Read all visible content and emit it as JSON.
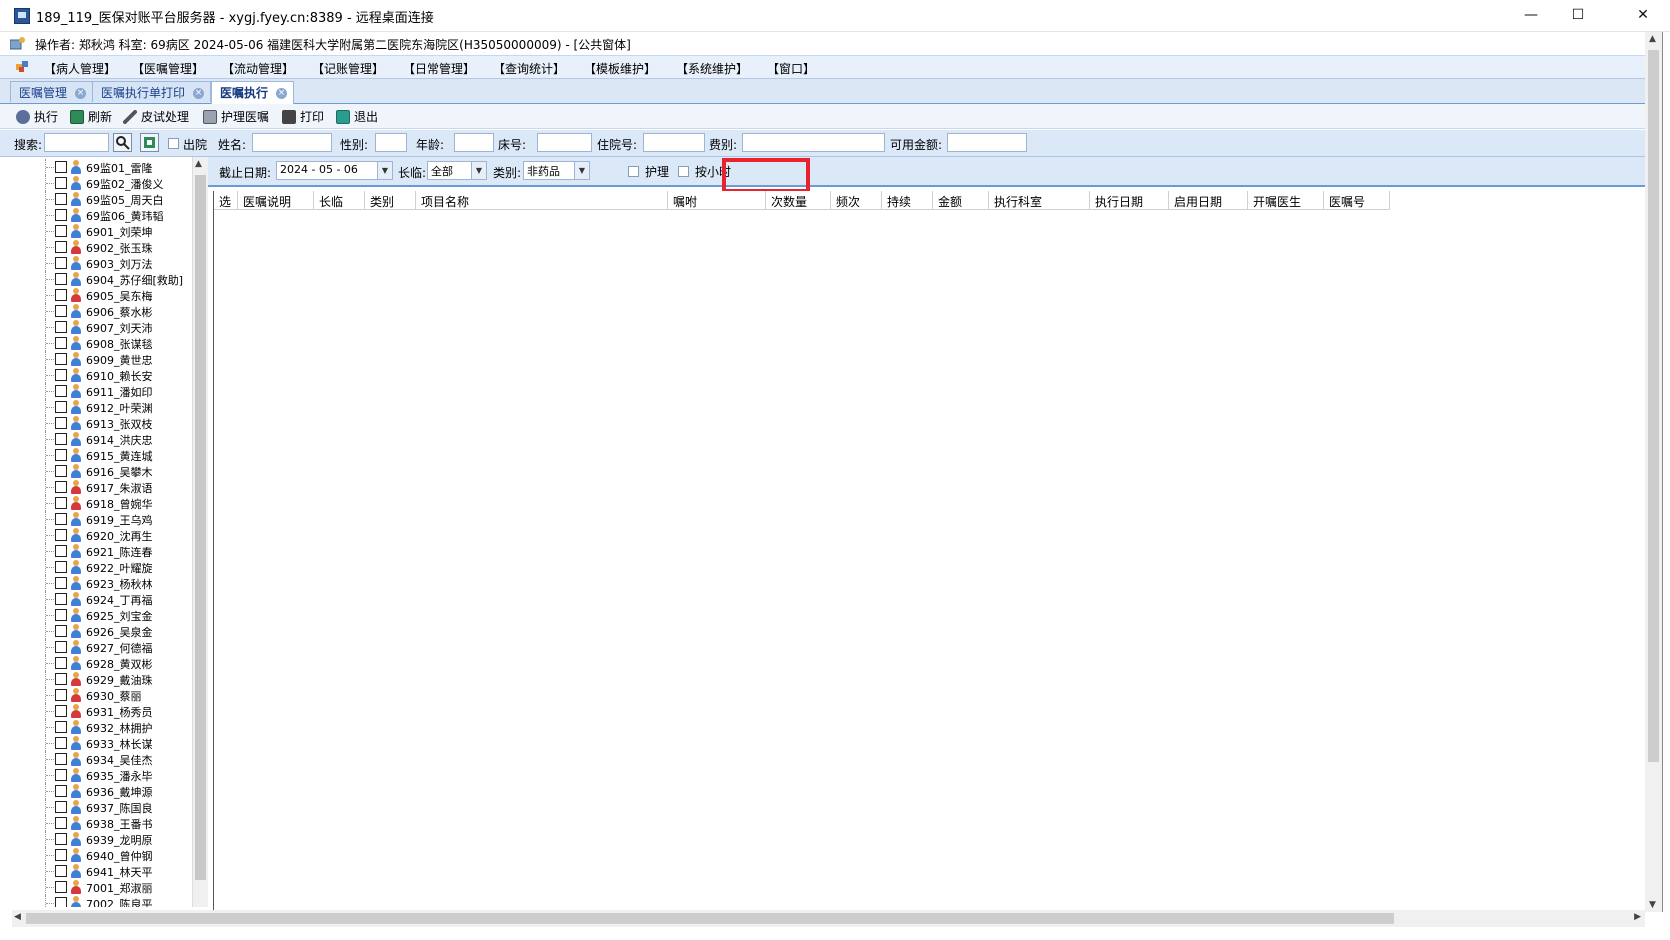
{
  "window": {
    "title": "189_119_医保对账平台服务器 - xygj.fyey.cn:8389 - 远程桌面连接",
    "minimize": "—",
    "maximize": "☐",
    "close": "✕"
  },
  "operator_line": "操作者: 郑秋鸿  科室: 69病区  2024-05-06  福建医科大学附属第二医院东海院区(H35050000009) - [公共窗体]",
  "menu": [
    "【病人管理】",
    "【医嘱管理】",
    "【流动管理】",
    "【记账管理】",
    "【日常管理】",
    "【查询统计】",
    "【模板维护】",
    "【系统维护】",
    "【窗口】"
  ],
  "tabs": [
    {
      "label": "医嘱管理",
      "close": "×"
    },
    {
      "label": "医嘱执行单打印",
      "close": "×"
    },
    {
      "label": "医嘱执行",
      "close": "×"
    }
  ],
  "toolbar": {
    "execute": "执行",
    "refresh": "刷新",
    "skin_test": "皮试处理",
    "nursing_orders": "护理医嘱",
    "print": "打印",
    "exit": "退出"
  },
  "search": {
    "label": "搜索:",
    "value": "",
    "discharged_label": "出院"
  },
  "patient_info": {
    "name_label": "姓名:",
    "gender_label": "性别:",
    "age_label": "年龄:",
    "bed_label": "床号:",
    "inpatient_no_label": "住院号:",
    "fee_type_label": "费别:",
    "available_amount_label": "可用金额:"
  },
  "filters": {
    "deadline_label": "截止日期:",
    "deadline_value": "2024 - 05 - 06",
    "duration_label": "长临:",
    "duration_value": "全部",
    "category_label": "类别:",
    "category_value": "非药品",
    "nursing_label": "护理",
    "hourly_label": "按小时"
  },
  "grid_columns": [
    "选",
    "医嘱说明",
    "长临",
    "类别",
    "项目名称",
    "嘱咐",
    "次数量",
    "频次",
    "持续",
    "金额",
    "执行科室",
    "执行日期",
    "启用日期",
    "开嘱医生",
    "医嘱号"
  ],
  "patients": [
    {
      "name": "69监01_雷隆",
      "gender": "male"
    },
    {
      "name": "69监02_潘俊义",
      "gender": "male"
    },
    {
      "name": "69监05_周天白",
      "gender": "male"
    },
    {
      "name": "69监06_黄玮韬",
      "gender": "male"
    },
    {
      "name": "6901_刘荣坤",
      "gender": "male"
    },
    {
      "name": "6902_张玉珠",
      "gender": "female"
    },
    {
      "name": "6903_刘万法",
      "gender": "male"
    },
    {
      "name": "6904_苏仔细[救助]",
      "gender": "male"
    },
    {
      "name": "6905_吴东梅",
      "gender": "female"
    },
    {
      "name": "6906_蔡水彬",
      "gender": "male"
    },
    {
      "name": "6907_刘天沛",
      "gender": "male"
    },
    {
      "name": "6908_张谋毯",
      "gender": "male"
    },
    {
      "name": "6909_黄世忠",
      "gender": "male"
    },
    {
      "name": "6910_赖长安",
      "gender": "male"
    },
    {
      "name": "6911_潘如印",
      "gender": "male"
    },
    {
      "name": "6912_叶荣渊",
      "gender": "male"
    },
    {
      "name": "6913_张双枝",
      "gender": "male"
    },
    {
      "name": "6914_洪庆忠",
      "gender": "male"
    },
    {
      "name": "6915_黄连城",
      "gender": "male"
    },
    {
      "name": "6916_吴攀木",
      "gender": "male"
    },
    {
      "name": "6917_朱淑语",
      "gender": "female"
    },
    {
      "name": "6918_曾婉华",
      "gender": "female"
    },
    {
      "name": "6919_王乌鸡",
      "gender": "male"
    },
    {
      "name": "6920_沈再生",
      "gender": "male"
    },
    {
      "name": "6921_陈连春",
      "gender": "male"
    },
    {
      "name": "6922_叶耀旋",
      "gender": "male"
    },
    {
      "name": "6923_杨秋林",
      "gender": "male"
    },
    {
      "name": "6924_丁再福",
      "gender": "male"
    },
    {
      "name": "6925_刘宝金",
      "gender": "male"
    },
    {
      "name": "6926_吴泉金",
      "gender": "male"
    },
    {
      "name": "6927_何德福",
      "gender": "male"
    },
    {
      "name": "6928_黄双彬",
      "gender": "male"
    },
    {
      "name": "6929_戴油珠",
      "gender": "female"
    },
    {
      "name": "6930_蔡丽",
      "gender": "female"
    },
    {
      "name": "6931_杨秀员",
      "gender": "female"
    },
    {
      "name": "6932_林拥护",
      "gender": "male"
    },
    {
      "name": "6933_林长谋",
      "gender": "male"
    },
    {
      "name": "6934_吴佳杰",
      "gender": "male"
    },
    {
      "name": "6935_潘永毕",
      "gender": "male"
    },
    {
      "name": "6936_戴坤源",
      "gender": "male"
    },
    {
      "name": "6937_陈国良",
      "gender": "male"
    },
    {
      "name": "6938_王番书",
      "gender": "male"
    },
    {
      "name": "6939_龙明原",
      "gender": "male"
    },
    {
      "name": "6940_曾仲钢",
      "gender": "male"
    },
    {
      "name": "6941_林天平",
      "gender": "male"
    },
    {
      "name": "7001_郑淑丽",
      "gender": "female"
    },
    {
      "name": "7002_陈良平",
      "gender": "male"
    }
  ],
  "colors": {
    "male_icon": "#3f7fd6",
    "female_icon": "#d43a3a",
    "highlight_box": "#e8232c",
    "menu_bg": "#e8f0fb",
    "tab_text": "#1b3f8a"
  }
}
